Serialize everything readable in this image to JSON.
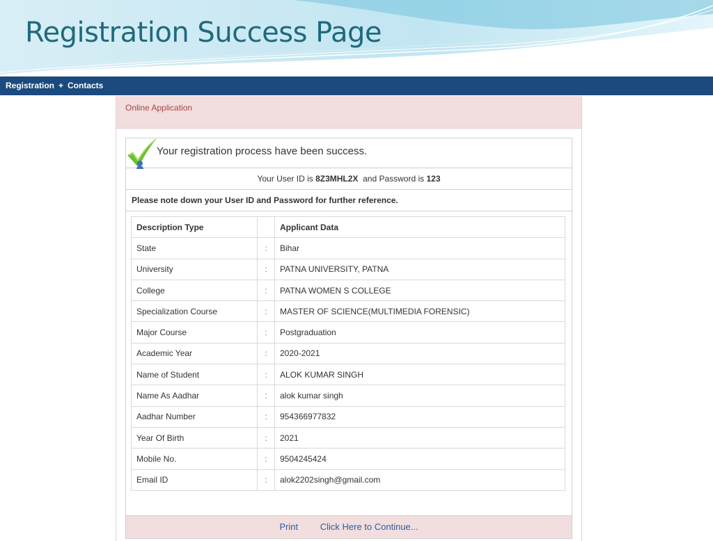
{
  "slide": {
    "title": "Registration Success Page"
  },
  "nav": {
    "items": [
      {
        "label": "Registration",
        "suffix": "+"
      },
      {
        "label": "Contacts"
      }
    ]
  },
  "panel": {
    "title": "Online Application",
    "success_message": "Your registration process have been success.",
    "userid_prefix": "Your User ID is ",
    "user_id": "8Z3MHL2X",
    "password_prefix": "  and Password is ",
    "password": "123",
    "note": "Please note down your User ID and Password for further reference."
  },
  "table": {
    "headers": [
      "Description Type",
      "",
      "Applicant Data"
    ],
    "rows": [
      {
        "label": "State",
        "sep": ":",
        "value": "Bihar"
      },
      {
        "label": "University",
        "sep": ":",
        "value": "PATNA UNIVERSITY, PATNA"
      },
      {
        "label": "College",
        "sep": ":",
        "value": "PATNA WOMEN S COLLEGE"
      },
      {
        "label": "Specialization Course",
        "sep": ":",
        "value": "MASTER OF SCIENCE(MULTIMEDIA FORENSIC)"
      },
      {
        "label": "Major Course",
        "sep": ":",
        "value": "Postgraduation"
      },
      {
        "label": "Academic Year",
        "sep": ":",
        "value": "2020-2021"
      },
      {
        "label": "Name of Student",
        "sep": ":",
        "value": "ALOK KUMAR SINGH"
      },
      {
        "label": "Name As Aadhar",
        "sep": ":",
        "value": "alok kumar singh"
      },
      {
        "label": "Aadhar Number",
        "sep": ":",
        "value": "954366977832"
      },
      {
        "label": "Year Of Birth",
        "sep": ":",
        "value": "2021"
      },
      {
        "label": "Mobile No.",
        "sep": ":",
        "value": "9504245424"
      },
      {
        "label": "Email ID",
        "sep": ":",
        "value": "alok2202singh@gmail.com"
      }
    ]
  },
  "footer": {
    "print_label": "Print",
    "continue_label": "Click Here to Continue..."
  },
  "colors": {
    "title": "#1f6a7d",
    "navbar": "#1a4a7e",
    "panel_header_bg": "#f2dede",
    "panel_header_text": "#a94442",
    "link": "#2a5da5",
    "check": "#6cbf2d"
  },
  "icons": {
    "success": "check-mark-icon"
  }
}
